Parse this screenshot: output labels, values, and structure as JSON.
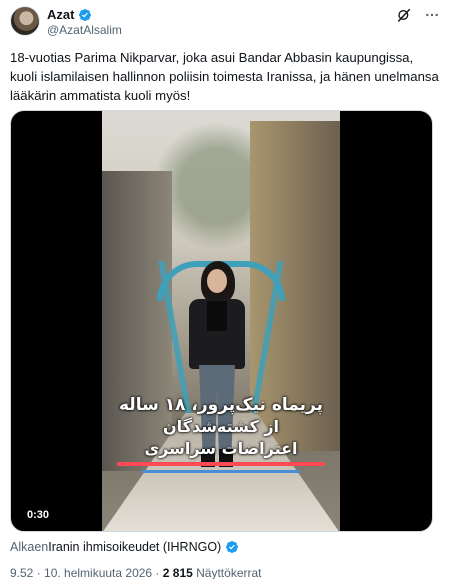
{
  "author": {
    "display_name": "Azat",
    "handle": "@AzatAlsalim",
    "verified": true
  },
  "top_icons": [
    "grok-icon",
    "more-icon"
  ],
  "tweet": {
    "text": "18-vuotias Parima Nikparvar, joka asui Bandar Abbasin kaupungissa, kuoli islamilaisen hallinnon poliisin toimesta Iranissa, ja hänen unelmansa lääkärin ammatista kuoli myös!"
  },
  "video": {
    "caption_line1": "پریماه نیک‌پرور، ۱۸ ساله",
    "caption_line2": "از کشته‌شدگان",
    "caption_line3": "اعتراضات سراسری",
    "duration": "0:30"
  },
  "source": {
    "prefix": "Alkaen",
    "name": "Iranin ihmisoikeudet (IHRNGO)",
    "verified": true
  },
  "meta": {
    "time_date": "9.52 · 10. helmikuuta 2026 · ",
    "views_count": "2 815",
    "views_label": " Näyttökerrat"
  },
  "colors": {
    "verified_blue": "#1d9bf0",
    "text_secondary": "#536471",
    "caption_red_bar": "#ff4a55",
    "caption_blue_bar": "#4a8ed8"
  }
}
